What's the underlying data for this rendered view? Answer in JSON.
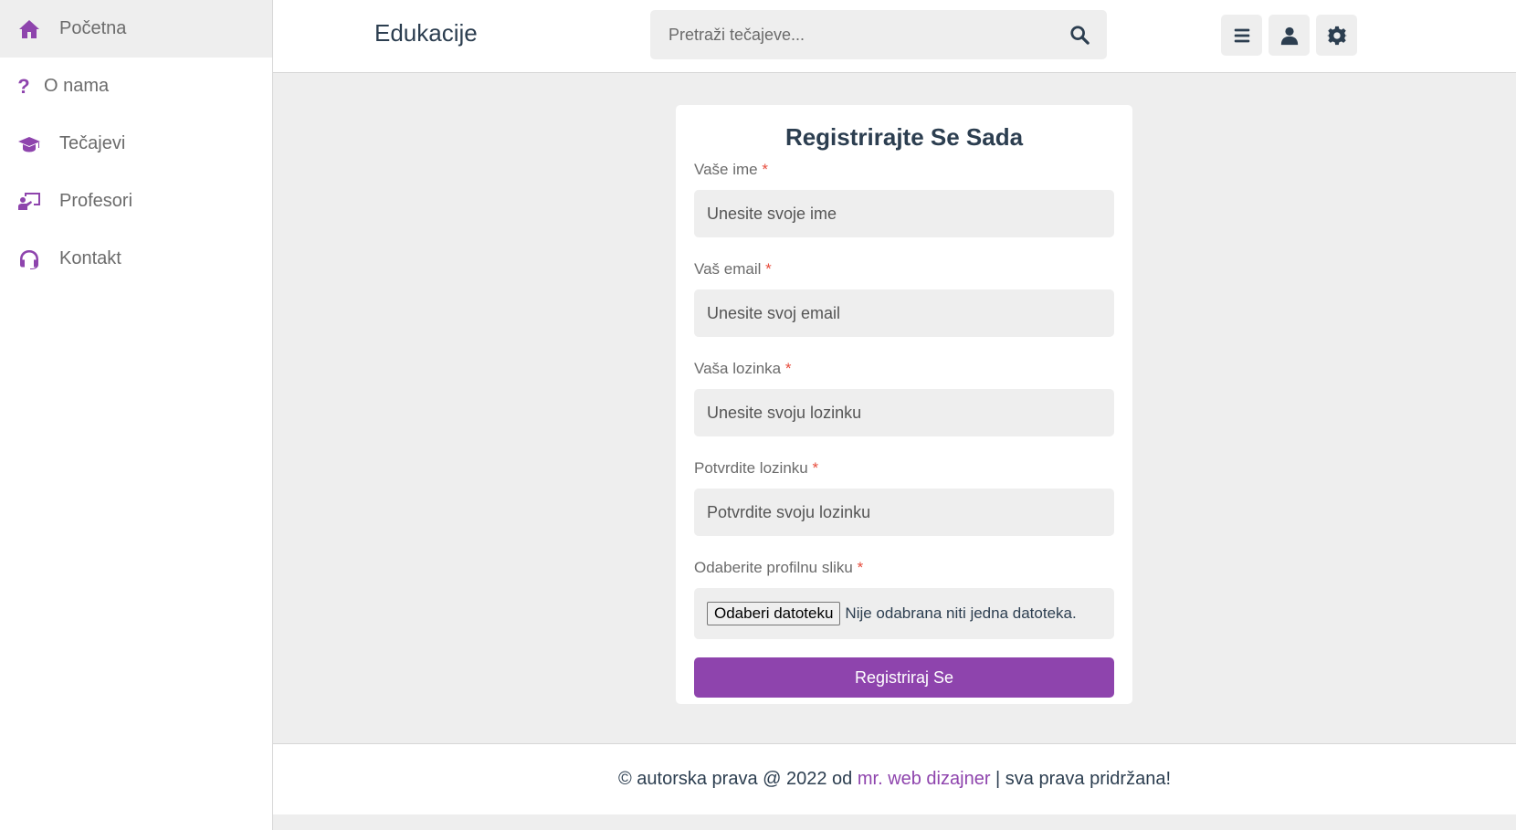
{
  "sidebar": {
    "items": [
      {
        "label": "Početna",
        "icon": "home-icon",
        "active": true
      },
      {
        "label": "O nama",
        "icon": "question-icon"
      },
      {
        "label": "Tečajevi",
        "icon": "graduation-cap-icon"
      },
      {
        "label": "Profesori",
        "icon": "chalkboard-teacher-icon"
      },
      {
        "label": "Kontakt",
        "icon": "headset-icon"
      }
    ]
  },
  "header": {
    "brand": "Edukacije",
    "search_placeholder": "Pretraži tečajeve...",
    "buttons": [
      "menu-icon",
      "user-icon",
      "gear-icon"
    ]
  },
  "form": {
    "title": "Registrirajte Se Sada",
    "required_mark": "*",
    "name_label": "Vaše ime",
    "name_placeholder": "Unesite svoje ime",
    "email_label": "Vaš email",
    "email_placeholder": "Unesite svoj email",
    "password_label": "Vaša lozinka",
    "password_placeholder": "Unesite svoju lozinku",
    "confirm_label": "Potvrdite lozinku",
    "confirm_placeholder": "Potvrdite svoju lozinku",
    "image_label": "Odaberite profilnu sliku",
    "file_button": "Odaberi datoteku",
    "file_status": "Nije odabrana niti jedna datoteka.",
    "submit": "Registriraj Se"
  },
  "footer": {
    "prefix": "© autorska prava @ 2022 od",
    "author": "mr. web dizajner",
    "suffix": "| sva prava pridržana!"
  },
  "colors": {
    "accent": "#8e44ad",
    "text": "#2c3e50",
    "background": "#eeeeee",
    "required": "#e74c3c"
  }
}
